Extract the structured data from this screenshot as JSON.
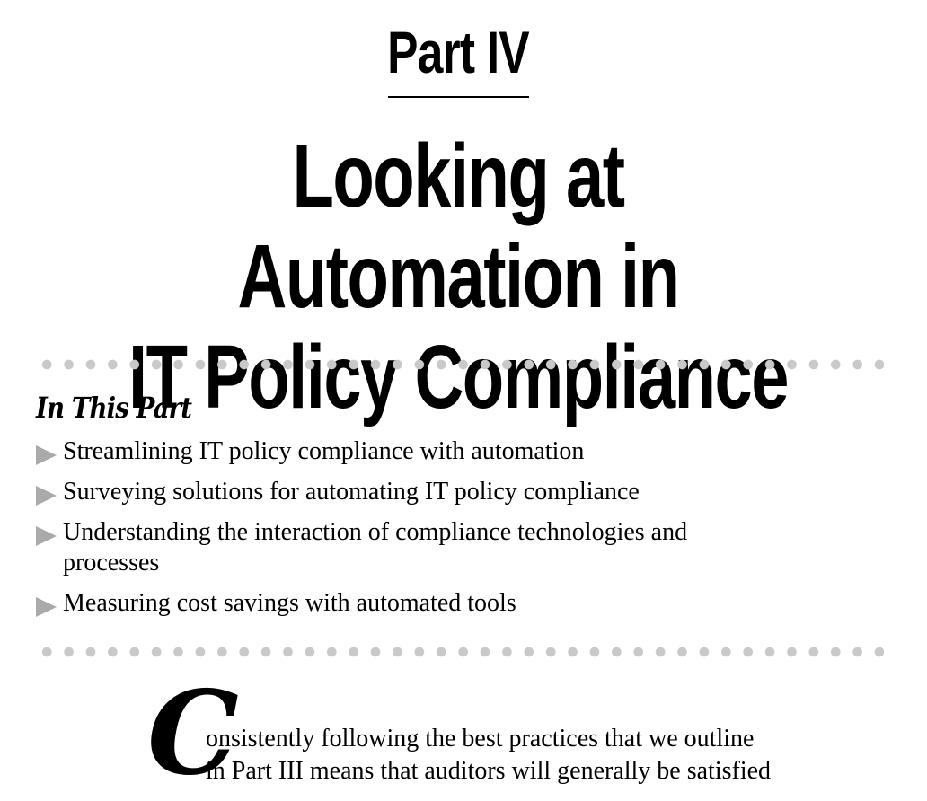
{
  "part": {
    "label": "Part IV",
    "title_line1": "Looking at Automation in",
    "title_line2": "IT Policy Compliance"
  },
  "in_this_part": {
    "heading": "In This Part",
    "items": [
      "Streamlining IT policy compliance with automation",
      "Surveying solutions for automating IT policy compliance",
      "Understanding the interaction of compliance technologies and",
      "processes",
      "Measuring cost savings with automated tools"
    ]
  },
  "intro": {
    "drop_cap": "C",
    "line1": "onsistently following the best practices that we outline",
    "line2": "in Part III means that auditors will generally be satisfied"
  },
  "colors": {
    "text": "#000000",
    "dots": "#c9c9c9",
    "arrow": "#aaaaaa"
  },
  "icons": {
    "bullet": "right-triangle-arrow"
  }
}
